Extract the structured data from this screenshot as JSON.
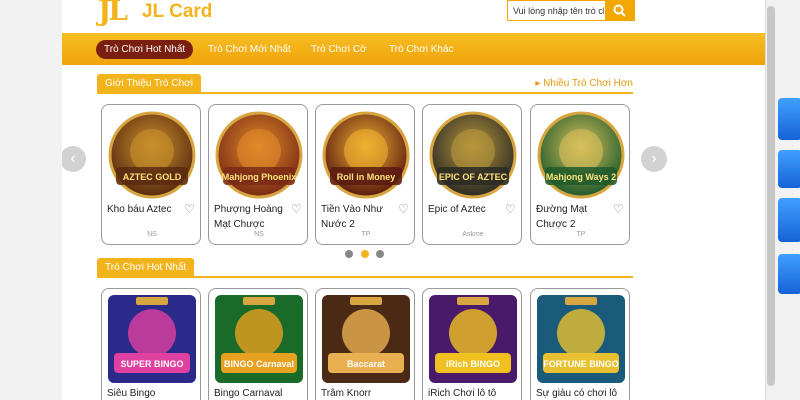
{
  "header": {
    "logo_mark": "JL",
    "logo_text": "JL Card",
    "search_placeholder": "Vui lòng nhập tên trò chơi."
  },
  "nav": {
    "items": [
      {
        "label": "Trò Chơi Hot Nhất",
        "active": true
      },
      {
        "label": "Trò Chơi Mới Nhất",
        "active": false
      },
      {
        "label": "Trò Chơi Cờ",
        "active": false
      },
      {
        "label": "Trò Chơi Khác",
        "active": false
      }
    ]
  },
  "intro_section": {
    "title": "Giới Thiệu Trò Chơi",
    "more_link": "Nhiều Trò Chơi Hơn",
    "cards": [
      {
        "title": "Kho báu Aztec",
        "provider": "NS",
        "art_text": "AZTEC GOLD",
        "colors": [
          "#5a2a10",
          "#c8902c"
        ]
      },
      {
        "title": "Phượng Hoàng Mạt Chược",
        "provider": "NS",
        "art_text": "Mahjong Phoenix",
        "colors": [
          "#7a2a14",
          "#e08a2a"
        ]
      },
      {
        "title": "Tiền Vào Như Nước 2",
        "provider": "TP",
        "art_text": "Roll in Money",
        "colors": [
          "#5a1a10",
          "#f0b030"
        ]
      },
      {
        "title": "Epic of Aztec",
        "provider": "Askme",
        "art_text": "EPIC OF AZTEC",
        "colors": [
          "#2a2a24",
          "#b8963c"
        ]
      },
      {
        "title": "Đường Mạt Chược 2",
        "provider": "TP",
        "art_text": "Mahjong Ways 2",
        "colors": [
          "#1e5a2c",
          "#d8c05a"
        ]
      }
    ],
    "carousel_dots": 3,
    "carousel_active": 1
  },
  "hot_section": {
    "title": "Trò Chơi Hot Nhất",
    "cards": [
      {
        "title": "Siêu Bingo",
        "art_text": "SUPER BINGO",
        "colors": [
          "#2a2a8a",
          "#e040a0"
        ]
      },
      {
        "title": "Bingo Carnaval",
        "art_text": "BINGO Carnaval",
        "colors": [
          "#1a6a2a",
          "#e8a020"
        ]
      },
      {
        "title": "Trâm Knorr",
        "art_text": "Baccarat",
        "colors": [
          "#4a2a14",
          "#e8b050"
        ]
      },
      {
        "title": "iRich Chơi lô tô",
        "art_text": "iRich BINGO",
        "colors": [
          "#4a1a6a",
          "#f0c020"
        ]
      },
      {
        "title": "Sự giàu có chơi lô tô",
        "art_text": "FORTUNE BINGO",
        "colors": [
          "#1a5a7a",
          "#e8c030"
        ]
      }
    ]
  },
  "icons": {
    "search": "search-icon",
    "heart": "heart-icon",
    "prev": "chevron-left-icon",
    "next": "chevron-right-icon"
  }
}
